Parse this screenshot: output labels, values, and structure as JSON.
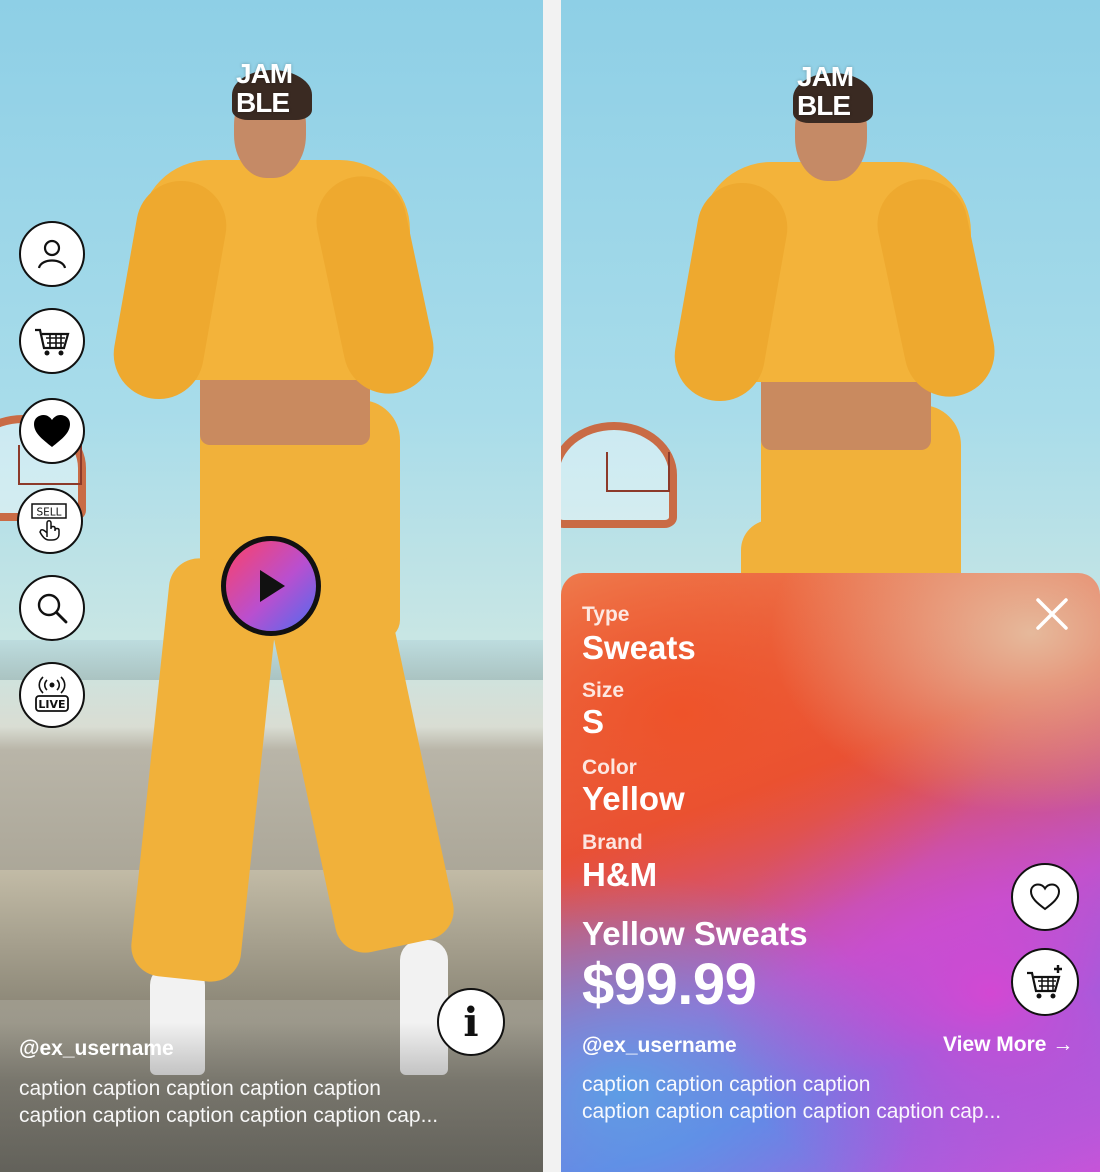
{
  "app": {
    "logo_line1": "JAM",
    "logo_line2": "BLE"
  },
  "feed": {
    "side_menu": [
      "profile-icon",
      "cart-icon",
      "heart-icon",
      "sell-icon",
      "search-icon",
      "live-icon"
    ],
    "sell_label": "SELL",
    "live_label": "LIVE",
    "info_label": "i",
    "username": "@ex_username",
    "caption_line1": "caption caption caption caption caption",
    "caption_line2": "caption caption caption caption caption cap..."
  },
  "product": {
    "type_label": "Type",
    "type_value": "Sweats",
    "size_label": "Size",
    "size_value": "S",
    "color_label": "Color",
    "color_value": "Yellow",
    "brand_label": "Brand",
    "brand_value": "H&M",
    "name": "Yellow Sweats",
    "price": "$99.99",
    "username": "@ex_username",
    "view_more": "View More →",
    "caption_line1": "caption caption caption caption",
    "caption_line2": "caption caption caption caption caption cap..."
  },
  "colors": {
    "accent_pink": "#f0447a",
    "accent_purple": "#b94fcf",
    "accent_blue": "#4e6cf0",
    "hoodie": "#f3b33a"
  }
}
